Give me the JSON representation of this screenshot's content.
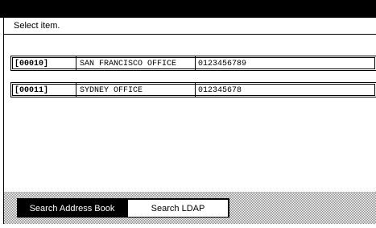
{
  "prompt": "Select item.",
  "entries": [
    {
      "id": "[00010]",
      "name": "SAN FRANCISCO OFFICE",
      "number": "0123456789"
    },
    {
      "id": "[00011]",
      "name": "SYDNEY OFFICE",
      "number": "012345678"
    }
  ],
  "tabs": [
    {
      "label": "Search Address Book",
      "active": true
    },
    {
      "label": "Search LDAP",
      "active": false
    }
  ],
  "colors": {
    "header_bar": "#000000",
    "active_tab": "#000000",
    "inactive_tab": "#ffffff"
  }
}
